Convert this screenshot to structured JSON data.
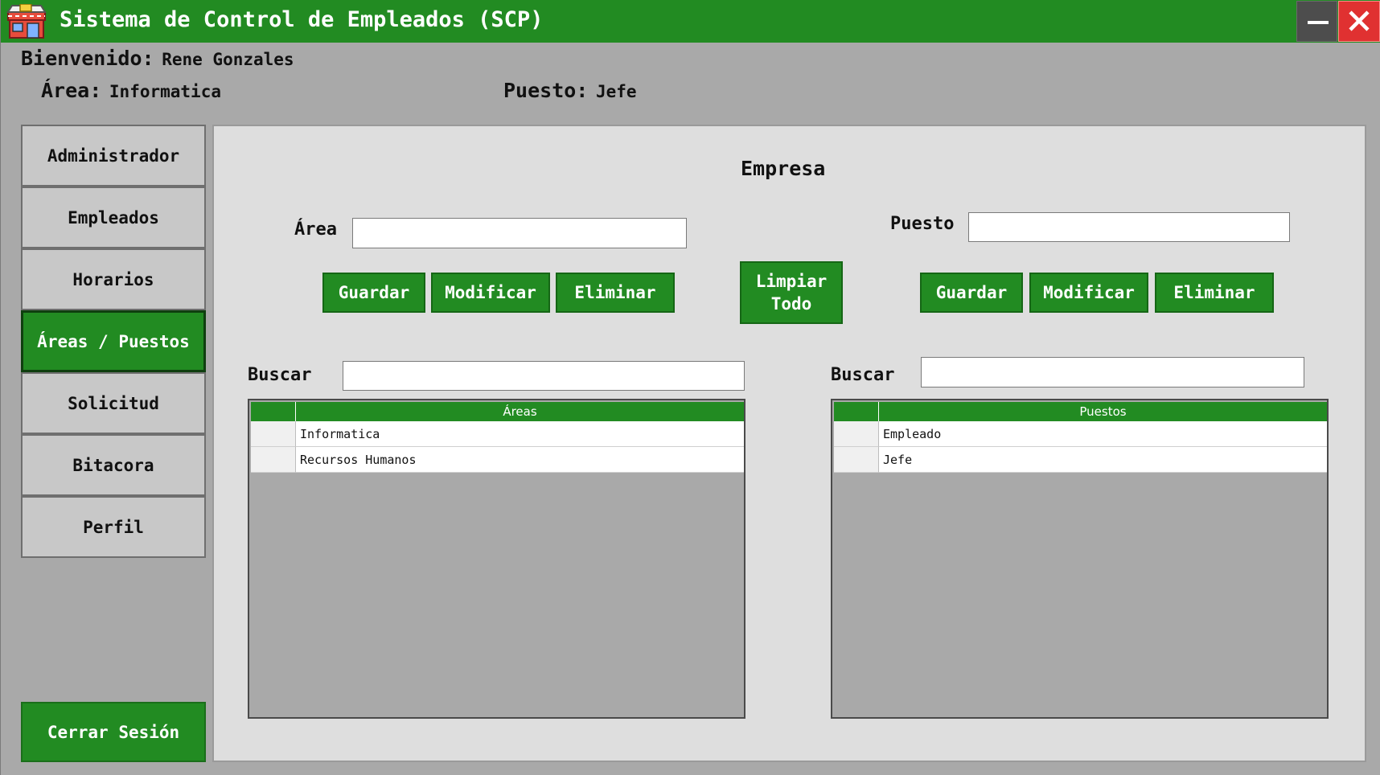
{
  "window": {
    "title": "Sistema de Control de Empleados (SCP)",
    "icons": {
      "app": "store-icon",
      "minimize": "minimize-icon",
      "close": "close-icon"
    }
  },
  "header": {
    "welcome_label": "Bienvenido:",
    "user_name": "Rene Gonzales",
    "area_label": "Área:",
    "area_value": "Informatica",
    "puesto_label": "Puesto:",
    "puesto_value": "Jefe"
  },
  "sidebar": {
    "items": [
      {
        "label": "Administrador",
        "active": false
      },
      {
        "label": "Empleados",
        "active": false
      },
      {
        "label": "Horarios",
        "active": false
      },
      {
        "label": "Áreas / Puestos",
        "active": true
      },
      {
        "label": "Solicitud",
        "active": false
      },
      {
        "label": "Bitacora",
        "active": false
      },
      {
        "label": "Perfil",
        "active": false
      }
    ],
    "logout_label": "Cerrar Sesión"
  },
  "main": {
    "title": "Empresa",
    "area": {
      "label": "Área",
      "value": "",
      "buttons": {
        "save": "Guardar",
        "modify": "Modificar",
        "delete": "Eliminar"
      },
      "search_label": "Buscar",
      "search_value": "",
      "table": {
        "column": "Áreas",
        "rows": [
          "Informatica",
          "Recursos Humanos"
        ]
      }
    },
    "clear_all_line1": "Limpiar",
    "clear_all_line2": "Todo",
    "puesto": {
      "label": "Puesto",
      "value": "",
      "buttons": {
        "save": "Guardar",
        "modify": "Modificar",
        "delete": "Eliminar"
      },
      "search_label": "Buscar",
      "search_value": "",
      "table": {
        "column": "Puestos",
        "rows": [
          "Empleado",
          "Jefe"
        ]
      }
    }
  },
  "colors": {
    "accent": "#228b22",
    "close_button": "#e03131",
    "minimize_button": "#4d4d4d",
    "background": "#a9a9a9",
    "panel": "#dedede"
  }
}
